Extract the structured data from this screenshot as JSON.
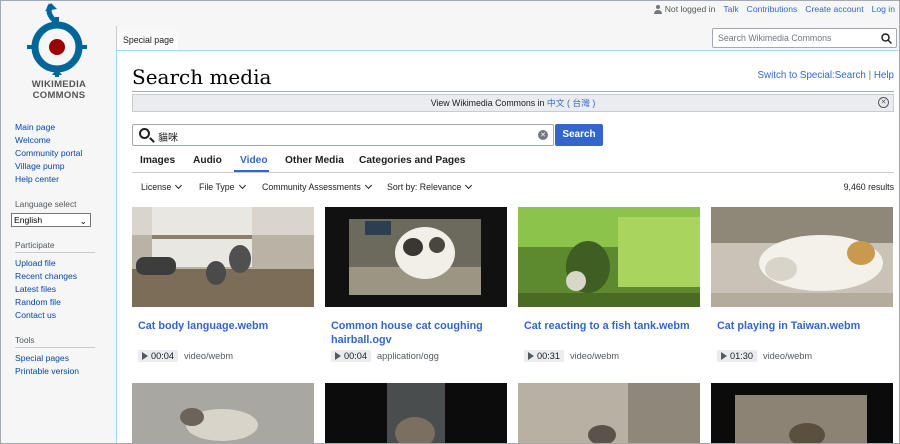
{
  "personal_tools": {
    "not_logged_in": "Not logged in",
    "talk": "Talk",
    "contributions": "Contributions",
    "create_account": "Create account",
    "log_in": "Log in"
  },
  "logo": {
    "line1": "WIKIMEDIA",
    "line2": "COMMONS",
    "icon": "wikimedia-commons-logo"
  },
  "sidebar": {
    "nav": [
      "Main page",
      "Welcome",
      "Community portal",
      "Village pump",
      "Help center"
    ],
    "language_heading": "Language select",
    "language_value": "English",
    "participate_heading": "Participate",
    "participate": [
      "Upload file",
      "Recent changes",
      "Latest files",
      "Random file",
      "Contact us"
    ],
    "tools_heading": "Tools",
    "tools": [
      "Special pages",
      "Printable version"
    ]
  },
  "header": {
    "tab_label": "Special page",
    "search_placeholder": "Search Wikimedia Commons"
  },
  "page": {
    "title": "Search media",
    "indicator_switch": "Switch to Special:Search",
    "indicator_sep": "|",
    "indicator_help": "Help",
    "notice_prefix": "View Wikimedia Commons in",
    "notice_link": "中文 ( 台灣 )"
  },
  "search": {
    "query": "貓咪",
    "button": "Search"
  },
  "tabs": [
    {
      "label": "Images",
      "active": false
    },
    {
      "label": "Audio",
      "active": false
    },
    {
      "label": "Video",
      "active": true
    },
    {
      "label": "Other Media",
      "active": false
    },
    {
      "label": "Categories and Pages",
      "active": false
    }
  ],
  "filters": {
    "license": "License",
    "file_type": "File Type",
    "assessments": "Community Assessments",
    "sort": "Sort by: Relevance",
    "results": "9,460 results"
  },
  "results": [
    {
      "title": "Cat body language.webm",
      "duration": "00:04",
      "mime": "video/webm"
    },
    {
      "title": "Common house cat coughing hairball.ogv",
      "duration": "00:04",
      "mime": "application/ogg"
    },
    {
      "title": "Cat reacting to a fish tank.webm",
      "duration": "00:31",
      "mime": "video/webm"
    },
    {
      "title": "Cat playing in Taiwan.webm",
      "duration": "01:30",
      "mime": "video/webm"
    }
  ],
  "colors": {
    "link": "#3366cc",
    "accent": "#3366cc"
  }
}
